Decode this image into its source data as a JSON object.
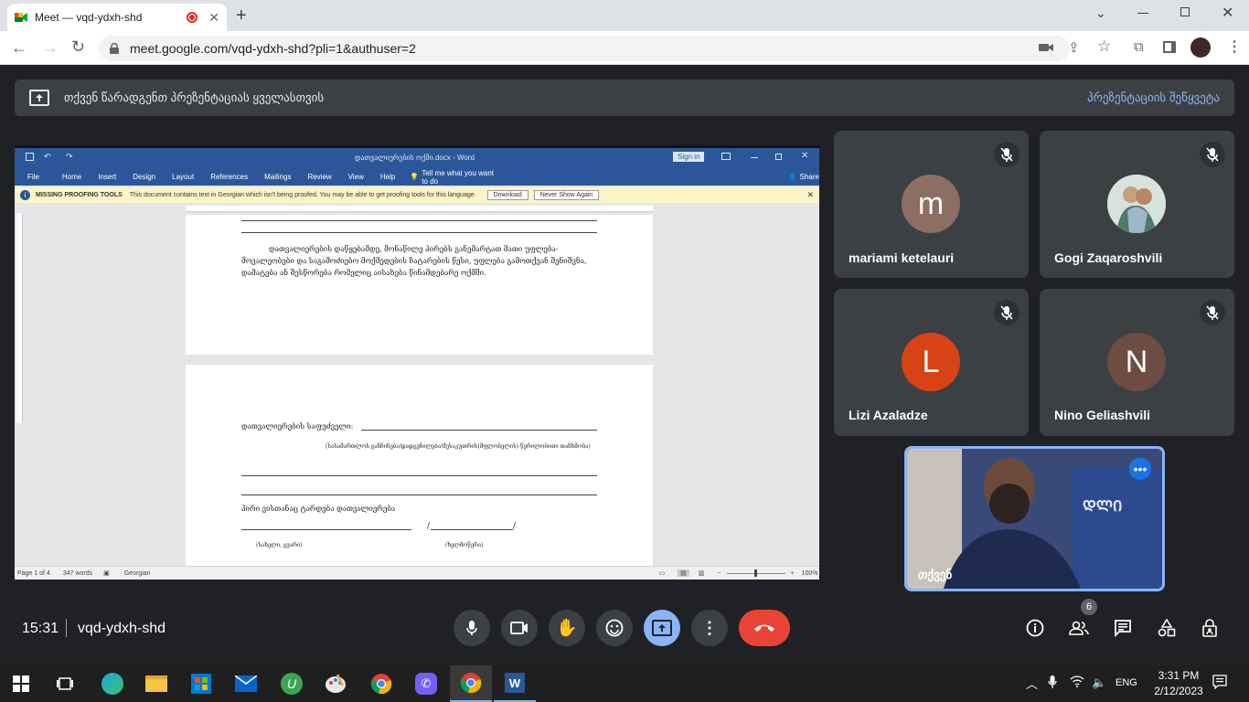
{
  "browser": {
    "tab_title": "Meet — vqd-ydxh-shd",
    "url": "meet.google.com/vqd-ydxh-shd?pli=1&authuser=2",
    "window_controls": [
      "minimize",
      "restore",
      "close"
    ]
  },
  "banner": {
    "text": "თქვენ წარადგენთ პრეზენტაციას ყველასთვის",
    "stop_label": "პრეზენტაციის შეწყვეტა"
  },
  "word": {
    "title": "დათვალიერების ოქმი.docx - Word",
    "sign_in": "Sign in",
    "menu": [
      "File",
      "Home",
      "Insert",
      "Design",
      "Layout",
      "References",
      "Mailings",
      "Review",
      "View",
      "Help"
    ],
    "tell_me": "Tell me what you want to do",
    "share": "Share",
    "proofing_title": "MISSING PROOFING TOOLS",
    "proofing_text": "This document contains text in Georgian which isn't being proofed. You may be able to get proofing tools for this language.",
    "download": "Download",
    "never_show": "Never Show Again",
    "page1_paragraph": "დათვალიერების დაწყებამდე, მონაწილე პირებს განემარტათ მათი უფლება-მოვალეობები და საგამოძიებო მოქმედების ჩატარების წესი, უფლება გამოთქვან შენიშვნა, დამატება ან შესწორება რომელიც აისახება წინამდებარე ოქმში.",
    "page2_basis": "დათვალიერების საფუძველი:",
    "page2_basis_note": "(სასამართლოს განჩინება/დადგენილება/მესაკუთრის(მფლობელის) წერილობითი თანხმობა)",
    "page2_person": "პირი ვისთანაც ტარდება დათვალიერება",
    "page2_name": "(სახელი, გვარი)",
    "page2_signature": "(ხელმოწერა)",
    "status_page": "Page 1 of 4",
    "status_words": "347 words",
    "status_lang": "Georgian",
    "zoom": "100%"
  },
  "participants": [
    {
      "name": "mariami ketelauri",
      "initial": "m",
      "color": "#8d6e63"
    },
    {
      "name": "Gogi Zaqaroshvili",
      "initial": "",
      "color": "#cfd8dc"
    },
    {
      "name": "Lizi Azaladze",
      "initial": "L",
      "color": "#d84315"
    },
    {
      "name": "Nino Geliashvili",
      "initial": "N",
      "color": "#6d4c41"
    }
  ],
  "self": {
    "label": "თქვენ"
  },
  "meeting": {
    "time": "15:31",
    "code": "vqd-ydxh-shd",
    "people_count": "6"
  },
  "taskbar": {
    "lang": "ENG",
    "time": "3:31 PM",
    "date": "2/12/2023"
  }
}
